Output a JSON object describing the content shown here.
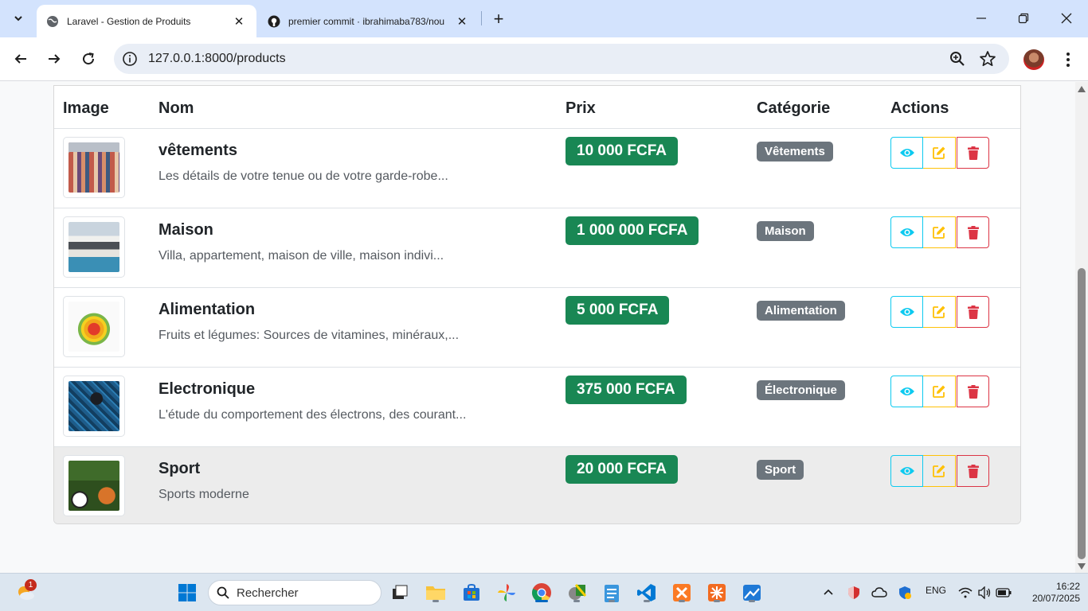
{
  "browser": {
    "tabs": [
      {
        "title": "Laravel - Gestion de Produits",
        "active": true
      },
      {
        "title": "premier commit · ibrahimaba783/nou",
        "active": false
      }
    ],
    "url": "127.0.0.1:8000/products"
  },
  "table": {
    "headers": {
      "image": "Image",
      "name": "Nom",
      "price": "Prix",
      "category": "Catégorie",
      "actions": "Actions"
    },
    "rows": [
      {
        "name": "vêtements",
        "description": "Les détails de votre tenue ou de votre garde-robe...",
        "price": "10 000 FCFA",
        "category": "Vêtements"
      },
      {
        "name": "Maison",
        "description": "Villa, appartement, maison de ville, maison indivi...",
        "price": "1 000 000 FCFA",
        "category": "Maison"
      },
      {
        "name": "Alimentation",
        "description": "Fruits et légumes: Sources de vitamines, minéraux,...",
        "price": "5 000 FCFA",
        "category": "Alimentation"
      },
      {
        "name": "Electronique",
        "description": "L'étude du comportement des électrons, des courant...",
        "price": "375 000 FCFA",
        "category": "Électronique"
      },
      {
        "name": "Sport",
        "description": "Sports moderne",
        "price": "20 000 FCFA",
        "category": "Sport"
      }
    ]
  },
  "taskbar": {
    "search_placeholder": "Rechercher",
    "weather_badge": "1",
    "language": "ENG",
    "time": "16:22",
    "date": "20/07/2025"
  },
  "colors": {
    "price_badge": "#198754",
    "category_badge": "#6c757d",
    "view_button": "#0dcaf0",
    "edit_button": "#ffc107",
    "delete_button": "#dc3545",
    "tabbar": "#d3e3fd"
  }
}
